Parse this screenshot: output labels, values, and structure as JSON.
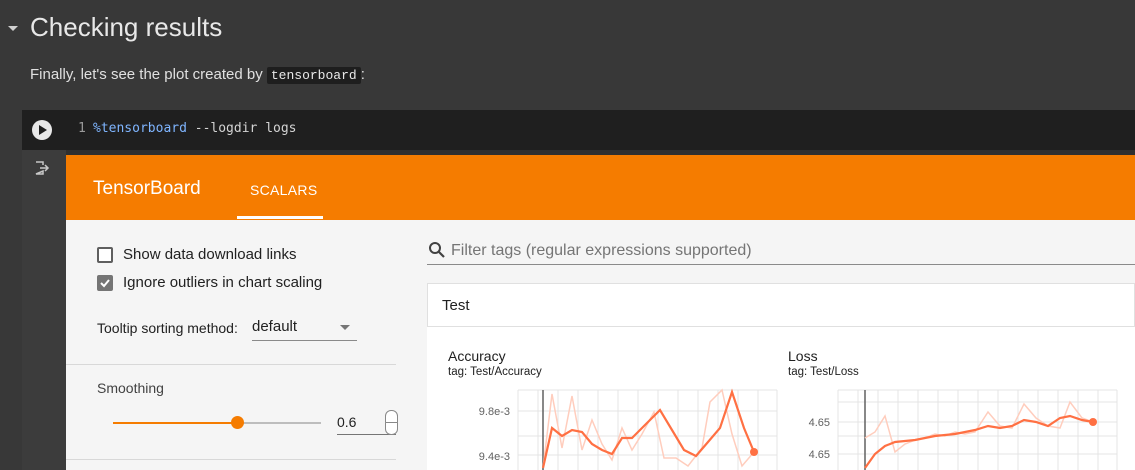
{
  "section": {
    "title": "Checking results"
  },
  "intro": {
    "prefix": "Finally, let's see the plot created by ",
    "code": "tensorboard",
    "suffix": ":"
  },
  "cell": {
    "line_number": "1",
    "code_magic": "%tensorboard",
    "code_args": " --logdir logs"
  },
  "tensorboard": {
    "brand": "TensorBoard",
    "active_tab": "SCALARS",
    "accent_color": "#f57c00",
    "sidebar": {
      "show_download_links": {
        "label": "Show data download links",
        "checked": false
      },
      "ignore_outliers": {
        "label": "Ignore outliers in chart scaling",
        "checked": true
      },
      "tooltip_sorting": {
        "label": "Tooltip sorting method:",
        "value": "default"
      },
      "smoothing": {
        "label": "Smoothing",
        "value": "0.6",
        "level": 0.6
      }
    },
    "filter": {
      "placeholder": "Filter tags (regular expressions supported)"
    },
    "group": {
      "title": "Test"
    },
    "charts": [
      {
        "title": "Accuracy",
        "tag": "tag: Test/Accuracy",
        "y_ticks": [
          "9.8e-3",
          "9.4e-3"
        ]
      },
      {
        "title": "Loss",
        "tag": "tag: Test/Loss",
        "y_ticks": [
          "4.65",
          "4.65"
        ]
      }
    ]
  },
  "icons": {
    "collapse": "chevron-down-icon",
    "run": "play-icon",
    "output": "output-exit-icon",
    "search": "search-icon",
    "check": "check-icon"
  }
}
